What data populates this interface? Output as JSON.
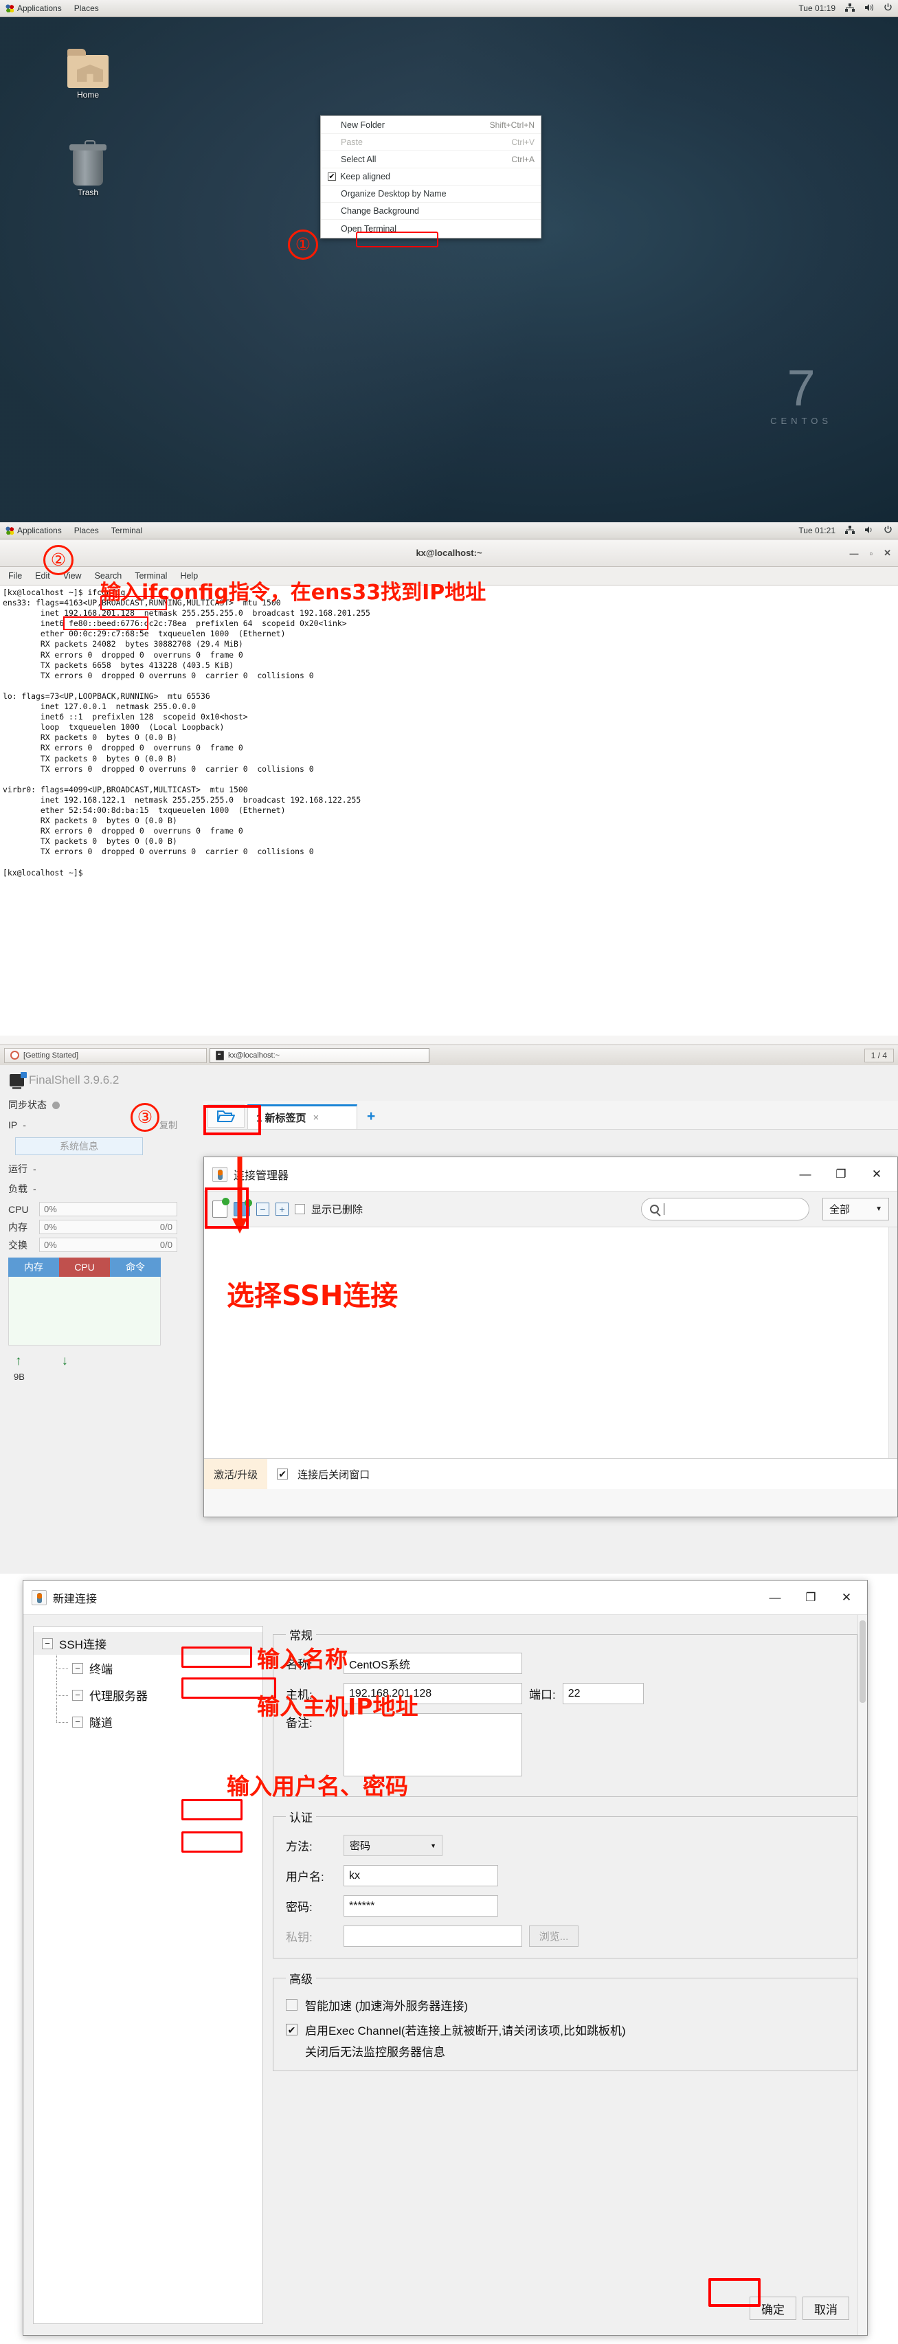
{
  "desktop": {
    "topbar": {
      "applications": "Applications",
      "places": "Places",
      "clock": "Tue 01:19"
    },
    "icons": [
      {
        "label": "Home",
        "icon": "home-folder-icon"
      },
      {
        "label": "Trash",
        "icon": "trash-icon"
      }
    ],
    "watermark": {
      "number": "7",
      "word": "CENTOS"
    },
    "context_menu": [
      {
        "label": "New Folder",
        "accel": "Shift+Ctrl+N",
        "disabled": false,
        "checked": null
      },
      {
        "label": "Paste",
        "accel": "Ctrl+V",
        "disabled": true,
        "checked": null
      },
      {
        "label": "Select All",
        "accel": "Ctrl+A",
        "disabled": false,
        "checked": null
      },
      {
        "label": "Keep aligned",
        "accel": "",
        "disabled": false,
        "checked": true
      },
      {
        "label": "Organize Desktop by Name",
        "accel": "",
        "disabled": false,
        "checked": null
      },
      {
        "label": "Change Background",
        "accel": "",
        "disabled": false,
        "checked": null
      },
      {
        "label": "Open Terminal",
        "accel": "",
        "disabled": false,
        "checked": null
      }
    ],
    "step_badge": "①"
  },
  "terminal": {
    "topbar": {
      "applications": "Applications",
      "places": "Places",
      "terminal": "Terminal",
      "clock": "Tue 01:21"
    },
    "window_title": "kx@localhost:~",
    "menu": [
      "File",
      "Edit",
      "View",
      "Search",
      "Terminal",
      "Help"
    ],
    "step_badge": "②",
    "annotation": "输入ifconfig指令，在ens33找到IP地址",
    "command": "ifconfig",
    "ip_address": "192.168.201.128",
    "output": "[kx@localhost ~]$ ifconfig\nens33: flags=4163<UP,BROADCAST,RUNNING,MULTICAST>  mtu 1500\n        inet 192.168.201.128  netmask 255.255.255.0  broadcast 192.168.201.255\n        inet6 fe80::beed:6776:dc2c:78ea  prefixlen 64  scopeid 0x20<link>\n        ether 00:0c:29:c7:68:5e  txqueuelen 1000  (Ethernet)\n        RX packets 24082  bytes 30882708 (29.4 MiB)\n        RX errors 0  dropped 0  overruns 0  frame 0\n        TX packets 6658  bytes 413228 (403.5 KiB)\n        TX errors 0  dropped 0 overruns 0  carrier 0  collisions 0\n\nlo: flags=73<UP,LOOPBACK,RUNNING>  mtu 65536\n        inet 127.0.0.1  netmask 255.0.0.0\n        inet6 ::1  prefixlen 128  scopeid 0x10<host>\n        loop  txqueuelen 1000  (Local Loopback)\n        RX packets 0  bytes 0 (0.0 B)\n        RX errors 0  dropped 0  overruns 0  frame 0\n        TX packets 0  bytes 0 (0.0 B)\n        TX errors 0  dropped 0 overruns 0  carrier 0  collisions 0\n\nvirbr0: flags=4099<UP,BROADCAST,MULTICAST>  mtu 1500\n        inet 192.168.122.1  netmask 255.255.255.0  broadcast 192.168.122.255\n        ether 52:54:00:8d:ba:15  txqueuelen 1000  (Ethernet)\n        RX packets 0  bytes 0 (0.0 B)\n        RX errors 0  dropped 0  overruns 0  frame 0\n        TX packets 0  bytes 0 (0.0 B)\n        TX errors 0  dropped 0 overruns 0  carrier 0  collisions 0\n\n[kx@localhost ~]$ ",
    "taskbar": {
      "item1": "[Getting Started]",
      "item2": "kx@localhost:~",
      "workspace": "1 / 4"
    }
  },
  "finalshell": {
    "app_title": "FinalShell 3.9.6.2",
    "step_badge": "③",
    "sidebar": {
      "sync_label": "同步状态",
      "ip_label": "IP",
      "ip_value": "-",
      "copy_label": "复制",
      "sysinfo_button": "系统信息",
      "uptime_label": "运行",
      "uptime_value": "-",
      "load_label": "负载",
      "load_value": "-",
      "meters": [
        {
          "name": "CPU",
          "percent": "0%",
          "detail": ""
        },
        {
          "name": "内存",
          "percent": "0%",
          "detail": "0/0"
        },
        {
          "name": "交换",
          "percent": "0%",
          "detail": "0/0"
        }
      ],
      "tabs": [
        "内存",
        "CPU",
        "命令"
      ],
      "traffic": "9B"
    },
    "tabbar": {
      "open_icon": "open-folder-icon",
      "tab_label": "1 新标签页",
      "close": "×",
      "plus": "+"
    },
    "connection_manager": {
      "title": "连接管理器",
      "window_buttons": {
        "minimize": "—",
        "maximize": "❐",
        "close": "✕"
      },
      "toolbar": {
        "new_connection_icon": "new-connection-icon",
        "new_folder_icon": "new-folder-icon",
        "collapse_icon": "−",
        "expand_icon": "+",
        "show_deleted_label": "显示已删除",
        "search_placeholder": "",
        "filter_value": "全部"
      },
      "annotation": "选择SSH连接",
      "footer": {
        "activate": "激活/升级",
        "close_after_connect": "连接后关闭窗口",
        "checked": true
      }
    }
  },
  "new_connection": {
    "title": "新建连接",
    "window_buttons": {
      "minimize": "—",
      "maximize": "❐",
      "close": "✕"
    },
    "tree": {
      "root": "SSH连接",
      "children": [
        "终端",
        "代理服务器",
        "隧道"
      ]
    },
    "general": {
      "legend": "常规",
      "name_label": "名称:",
      "name_value": "CentOS系统",
      "host_label": "主机:",
      "host_value": "192.168.201.128",
      "port_label": "端口:",
      "port_value": "22",
      "note_label": "备注:",
      "note_value": "",
      "annotation_name": "输入名称",
      "annotation_host": "输入主机IP地址"
    },
    "auth": {
      "legend": "认证",
      "method_label": "方法:",
      "method_value": "密码",
      "username_label": "用户名:",
      "username_value": "kx",
      "password_label": "密码:",
      "password_value": "******",
      "privatekey_label": "私钥:",
      "privatekey_value": "",
      "browse_button": "浏览...",
      "annotation": "输入用户名、密码"
    },
    "advanced": {
      "legend": "高级",
      "option1": "智能加速 (加速海外服务器连接)",
      "option1_checked": false,
      "option2": "启用Exec Channel(若连接上就被断开,请关闭该项,比如跳板机)",
      "option2_checked": true,
      "option2_note": "关闭后无法监控服务器信息"
    },
    "buttons": {
      "ok": "确定",
      "cancel": "取消"
    }
  },
  "colors": {
    "accent": "#1a84d6",
    "annotation": "#ff1a00",
    "terminal_bg": "#ffffff"
  }
}
